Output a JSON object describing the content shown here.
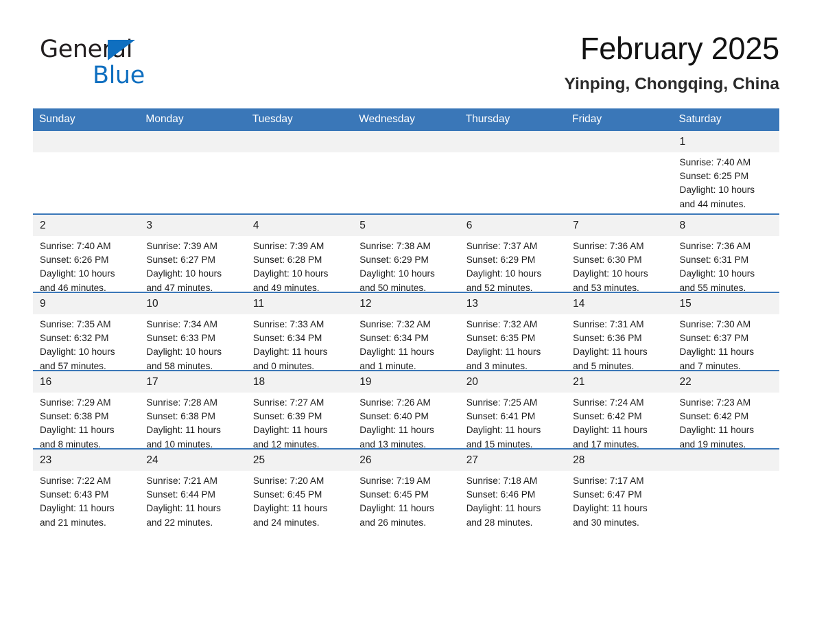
{
  "brand": {
    "word1": "General",
    "word2": "Blue",
    "triangle_icon": "triangle-logo-icon",
    "accent_color": "#0f6fc0"
  },
  "header": {
    "month_title": "February 2025",
    "location": "Yinping, Chongqing, China"
  },
  "calendar": {
    "header_color": "#3a77b8",
    "daynum_band_color": "#f2f2f2",
    "weekday_headers": [
      "Sunday",
      "Monday",
      "Tuesday",
      "Wednesday",
      "Thursday",
      "Friday",
      "Saturday"
    ],
    "weeks": [
      [
        {
          "day": "",
          "blank": true,
          "sunrise": "",
          "sunset": "",
          "daylight_line1": "",
          "daylight_line2": ""
        },
        {
          "day": "",
          "blank": true,
          "sunrise": "",
          "sunset": "",
          "daylight_line1": "",
          "daylight_line2": ""
        },
        {
          "day": "",
          "blank": true,
          "sunrise": "",
          "sunset": "",
          "daylight_line1": "",
          "daylight_line2": ""
        },
        {
          "day": "",
          "blank": true,
          "sunrise": "",
          "sunset": "",
          "daylight_line1": "",
          "daylight_line2": ""
        },
        {
          "day": "",
          "blank": true,
          "sunrise": "",
          "sunset": "",
          "daylight_line1": "",
          "daylight_line2": ""
        },
        {
          "day": "",
          "blank": true,
          "sunrise": "",
          "sunset": "",
          "daylight_line1": "",
          "daylight_line2": ""
        },
        {
          "day": "1",
          "blank": false,
          "sunrise": "Sunrise: 7:40 AM",
          "sunset": "Sunset: 6:25 PM",
          "daylight_line1": "Daylight: 10 hours",
          "daylight_line2": "and 44 minutes."
        }
      ],
      [
        {
          "day": "2",
          "blank": false,
          "sunrise": "Sunrise: 7:40 AM",
          "sunset": "Sunset: 6:26 PM",
          "daylight_line1": "Daylight: 10 hours",
          "daylight_line2": "and 46 minutes."
        },
        {
          "day": "3",
          "blank": false,
          "sunrise": "Sunrise: 7:39 AM",
          "sunset": "Sunset: 6:27 PM",
          "daylight_line1": "Daylight: 10 hours",
          "daylight_line2": "and 47 minutes."
        },
        {
          "day": "4",
          "blank": false,
          "sunrise": "Sunrise: 7:39 AM",
          "sunset": "Sunset: 6:28 PM",
          "daylight_line1": "Daylight: 10 hours",
          "daylight_line2": "and 49 minutes."
        },
        {
          "day": "5",
          "blank": false,
          "sunrise": "Sunrise: 7:38 AM",
          "sunset": "Sunset: 6:29 PM",
          "daylight_line1": "Daylight: 10 hours",
          "daylight_line2": "and 50 minutes."
        },
        {
          "day": "6",
          "blank": false,
          "sunrise": "Sunrise: 7:37 AM",
          "sunset": "Sunset: 6:29 PM",
          "daylight_line1": "Daylight: 10 hours",
          "daylight_line2": "and 52 minutes."
        },
        {
          "day": "7",
          "blank": false,
          "sunrise": "Sunrise: 7:36 AM",
          "sunset": "Sunset: 6:30 PM",
          "daylight_line1": "Daylight: 10 hours",
          "daylight_line2": "and 53 minutes."
        },
        {
          "day": "8",
          "blank": false,
          "sunrise": "Sunrise: 7:36 AM",
          "sunset": "Sunset: 6:31 PM",
          "daylight_line1": "Daylight: 10 hours",
          "daylight_line2": "and 55 minutes."
        }
      ],
      [
        {
          "day": "9",
          "blank": false,
          "sunrise": "Sunrise: 7:35 AM",
          "sunset": "Sunset: 6:32 PM",
          "daylight_line1": "Daylight: 10 hours",
          "daylight_line2": "and 57 minutes."
        },
        {
          "day": "10",
          "blank": false,
          "sunrise": "Sunrise: 7:34 AM",
          "sunset": "Sunset: 6:33 PM",
          "daylight_line1": "Daylight: 10 hours",
          "daylight_line2": "and 58 minutes."
        },
        {
          "day": "11",
          "blank": false,
          "sunrise": "Sunrise: 7:33 AM",
          "sunset": "Sunset: 6:34 PM",
          "daylight_line1": "Daylight: 11 hours",
          "daylight_line2": "and 0 minutes."
        },
        {
          "day": "12",
          "blank": false,
          "sunrise": "Sunrise: 7:32 AM",
          "sunset": "Sunset: 6:34 PM",
          "daylight_line1": "Daylight: 11 hours",
          "daylight_line2": "and 1 minute."
        },
        {
          "day": "13",
          "blank": false,
          "sunrise": "Sunrise: 7:32 AM",
          "sunset": "Sunset: 6:35 PM",
          "daylight_line1": "Daylight: 11 hours",
          "daylight_line2": "and 3 minutes."
        },
        {
          "day": "14",
          "blank": false,
          "sunrise": "Sunrise: 7:31 AM",
          "sunset": "Sunset: 6:36 PM",
          "daylight_line1": "Daylight: 11 hours",
          "daylight_line2": "and 5 minutes."
        },
        {
          "day": "15",
          "blank": false,
          "sunrise": "Sunrise: 7:30 AM",
          "sunset": "Sunset: 6:37 PM",
          "daylight_line1": "Daylight: 11 hours",
          "daylight_line2": "and 7 minutes."
        }
      ],
      [
        {
          "day": "16",
          "blank": false,
          "sunrise": "Sunrise: 7:29 AM",
          "sunset": "Sunset: 6:38 PM",
          "daylight_line1": "Daylight: 11 hours",
          "daylight_line2": "and 8 minutes."
        },
        {
          "day": "17",
          "blank": false,
          "sunrise": "Sunrise: 7:28 AM",
          "sunset": "Sunset: 6:38 PM",
          "daylight_line1": "Daylight: 11 hours",
          "daylight_line2": "and 10 minutes."
        },
        {
          "day": "18",
          "blank": false,
          "sunrise": "Sunrise: 7:27 AM",
          "sunset": "Sunset: 6:39 PM",
          "daylight_line1": "Daylight: 11 hours",
          "daylight_line2": "and 12 minutes."
        },
        {
          "day": "19",
          "blank": false,
          "sunrise": "Sunrise: 7:26 AM",
          "sunset": "Sunset: 6:40 PM",
          "daylight_line1": "Daylight: 11 hours",
          "daylight_line2": "and 13 minutes."
        },
        {
          "day": "20",
          "blank": false,
          "sunrise": "Sunrise: 7:25 AM",
          "sunset": "Sunset: 6:41 PM",
          "daylight_line1": "Daylight: 11 hours",
          "daylight_line2": "and 15 minutes."
        },
        {
          "day": "21",
          "blank": false,
          "sunrise": "Sunrise: 7:24 AM",
          "sunset": "Sunset: 6:42 PM",
          "daylight_line1": "Daylight: 11 hours",
          "daylight_line2": "and 17 minutes."
        },
        {
          "day": "22",
          "blank": false,
          "sunrise": "Sunrise: 7:23 AM",
          "sunset": "Sunset: 6:42 PM",
          "daylight_line1": "Daylight: 11 hours",
          "daylight_line2": "and 19 minutes."
        }
      ],
      [
        {
          "day": "23",
          "blank": false,
          "sunrise": "Sunrise: 7:22 AM",
          "sunset": "Sunset: 6:43 PM",
          "daylight_line1": "Daylight: 11 hours",
          "daylight_line2": "and 21 minutes."
        },
        {
          "day": "24",
          "blank": false,
          "sunrise": "Sunrise: 7:21 AM",
          "sunset": "Sunset: 6:44 PM",
          "daylight_line1": "Daylight: 11 hours",
          "daylight_line2": "and 22 minutes."
        },
        {
          "day": "25",
          "blank": false,
          "sunrise": "Sunrise: 7:20 AM",
          "sunset": "Sunset: 6:45 PM",
          "daylight_line1": "Daylight: 11 hours",
          "daylight_line2": "and 24 minutes."
        },
        {
          "day": "26",
          "blank": false,
          "sunrise": "Sunrise: 7:19 AM",
          "sunset": "Sunset: 6:45 PM",
          "daylight_line1": "Daylight: 11 hours",
          "daylight_line2": "and 26 minutes."
        },
        {
          "day": "27",
          "blank": false,
          "sunrise": "Sunrise: 7:18 AM",
          "sunset": "Sunset: 6:46 PM",
          "daylight_line1": "Daylight: 11 hours",
          "daylight_line2": "and 28 minutes."
        },
        {
          "day": "28",
          "blank": false,
          "sunrise": "Sunrise: 7:17 AM",
          "sunset": "Sunset: 6:47 PM",
          "daylight_line1": "Daylight: 11 hours",
          "daylight_line2": "and 30 minutes."
        },
        {
          "day": "",
          "blank": true,
          "sunrise": "",
          "sunset": "",
          "daylight_line1": "",
          "daylight_line2": ""
        }
      ]
    ]
  }
}
